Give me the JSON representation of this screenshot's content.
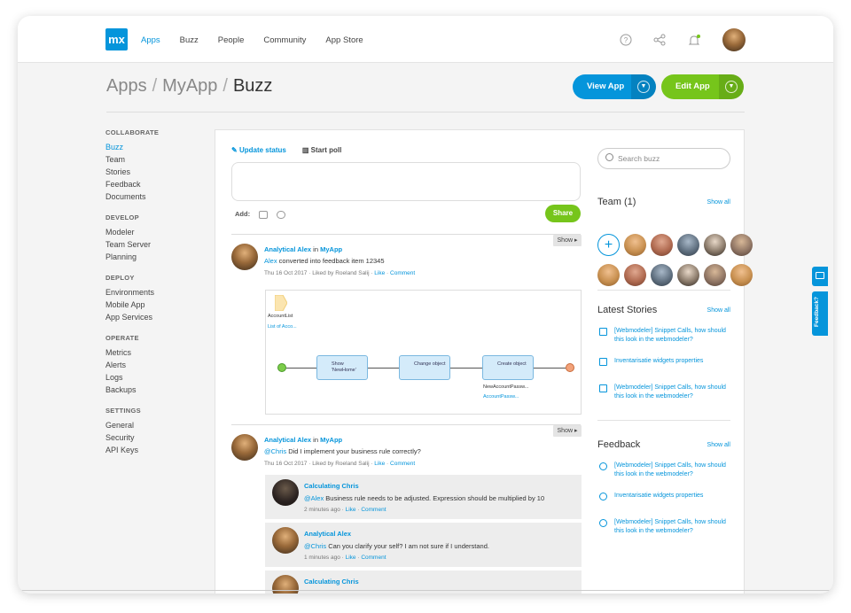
{
  "nav": {
    "logo": "mx",
    "items": [
      {
        "label": "Apps",
        "active": true
      },
      {
        "label": "Buzz",
        "active": false
      },
      {
        "label": "People",
        "active": false
      },
      {
        "label": "Community",
        "active": false
      },
      {
        "label": "App Store",
        "active": false
      }
    ]
  },
  "breadcrumb": {
    "parts": [
      "Apps",
      "MyApp"
    ],
    "sep": "/",
    "current": "Buzz"
  },
  "actions": {
    "view_label": "View App",
    "edit_label": "Edit App",
    "view_color": "#0595db",
    "edit_color": "#76c51b"
  },
  "sidebar": {
    "sections": [
      {
        "title": "COLLABORATE",
        "items": [
          "Buzz",
          "Team",
          "Stories",
          "Feedback",
          "Documents"
        ]
      },
      {
        "title": "DEVELOP",
        "items": [
          "Modeler",
          "Team Server",
          "Planning"
        ]
      },
      {
        "title": "DEPLOY",
        "items": [
          "Environments",
          "Mobile App",
          "App Services"
        ]
      },
      {
        "title": "OPERATE",
        "items": [
          "Metrics",
          "Alerts",
          "Logs",
          "Backups"
        ]
      },
      {
        "title": "SETTINGS",
        "items": [
          "General",
          "Security",
          "API Keys"
        ]
      }
    ],
    "active": "Buzz"
  },
  "compose": {
    "update_status": "Update status",
    "start_poll": "Start poll",
    "add_label": "Add:",
    "share_label": "Share"
  },
  "posts": [
    {
      "show_label": "Show ▸",
      "author": "Analytical Alex",
      "in": " in ",
      "app": "MyApp",
      "mention": "Alex",
      "text": " converted into feedback item 12345",
      "meta": "Thu 16 Oct 2017 · Liked by Roeland Salij · ",
      "like": "Like",
      "comment": "Comment",
      "diagram": {
        "entity": "AccountList",
        "entity_sub": "List of Acco...",
        "nodes": [
          "Show 'NewHome'",
          "Change object",
          "Create object"
        ],
        "out_label": "NewAccountPassw...",
        "out_sub": "AccountPassw..."
      }
    },
    {
      "show_label": "Show ▸",
      "author": "Analytical Alex",
      "in": " in ",
      "app": "MyApp",
      "mention": "@Chris",
      "text": " Did I implement your business rule correctly?",
      "meta": "Thu 16 Oct 2017 · Liked by Roeland Salij · ",
      "like": "Like",
      "comment": "Comment",
      "replies": [
        {
          "author": "Calculating Chris",
          "mention": "@Alex",
          "text": " Business rule needs to be adjusted. Expression should be multiplied by 10",
          "meta": "2 minutes ago · ",
          "like": "Like",
          "comment": "Comment"
        },
        {
          "author": "Analytical Alex",
          "mention": "@Chris",
          "text": " Can you clarify your self? I am not sure if I understand.",
          "meta": "1 minutes ago · ",
          "like": "Like",
          "comment": "Comment"
        },
        {
          "author": "Calculating Chris"
        }
      ]
    }
  ],
  "right": {
    "search_placeholder": "Search buzz",
    "team_title": "Team (1)",
    "show_all": "Show all",
    "stories_title": "Latest Stories",
    "stories": [
      "[Webmodeler] Snippet Calls, how should this look in the webmodeler?",
      "Inventarisatie widgets properties",
      "[Webmodeler] Snippet Calls, how should this look in the webmodeler?"
    ],
    "feedback_title": "Feedback",
    "feedback": [
      "[Webmodeler] Snippet Calls, how should this look in the webmodeler?",
      "Inventarisatie widgets properties",
      "[Webmodeler] Snippet Calls, how should this look in the webmodeler?"
    ]
  },
  "feedback_tab": "Feedback?"
}
